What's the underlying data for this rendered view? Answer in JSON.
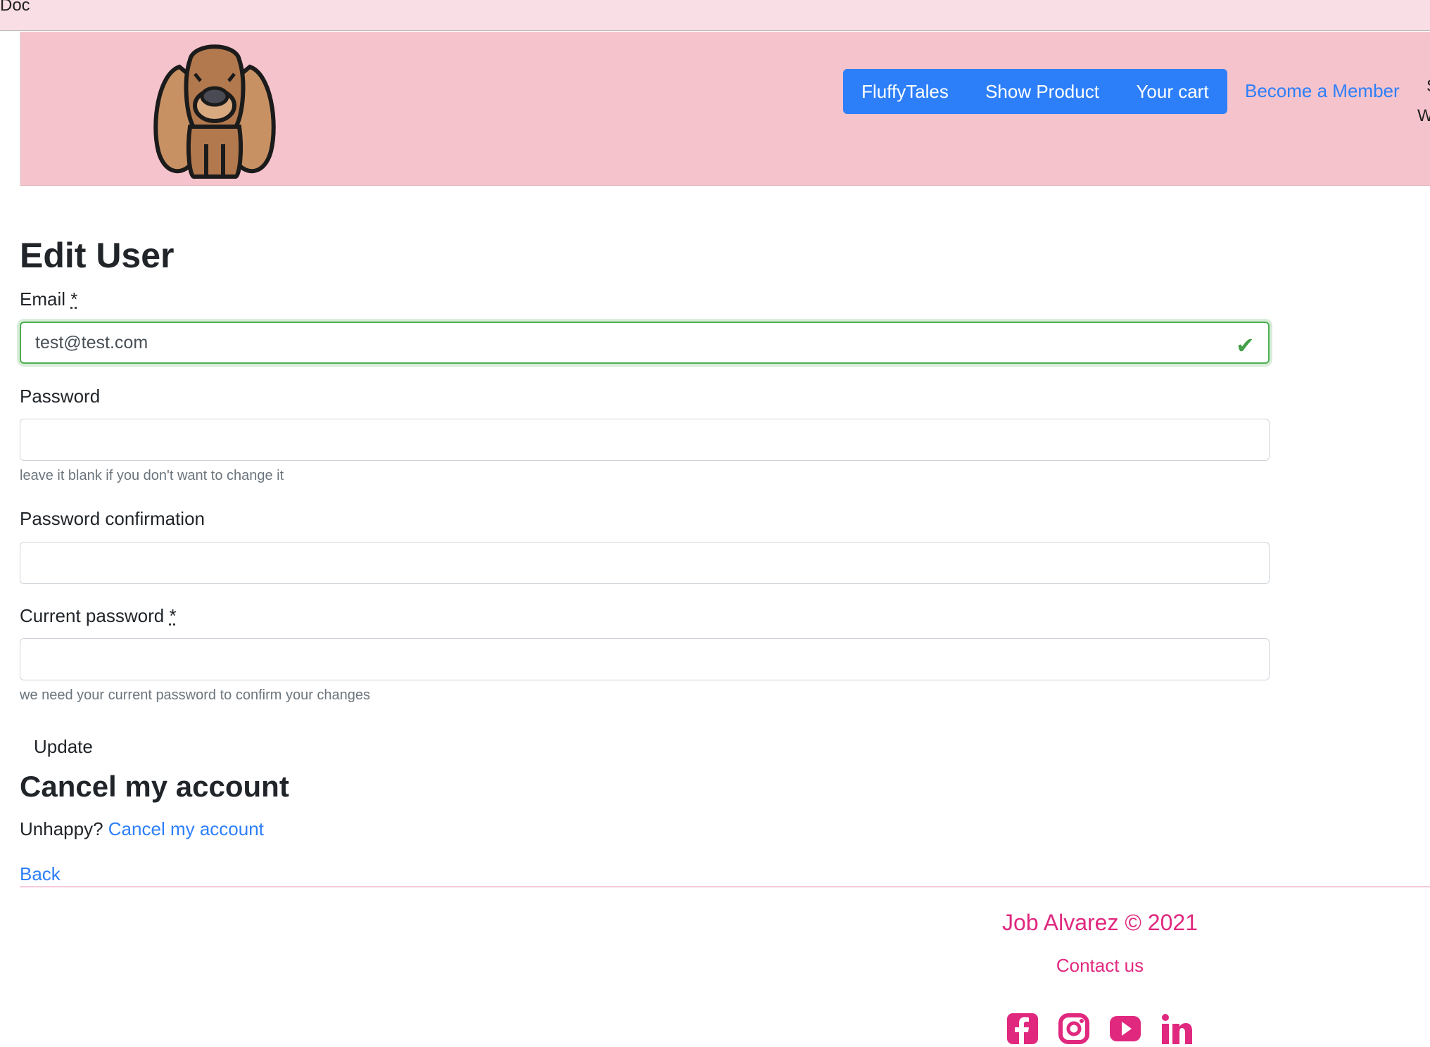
{
  "browser": {
    "tab_title": "Doc"
  },
  "nav": {
    "buttons": [
      "FluffyTales",
      "Show Product",
      "Your cart"
    ],
    "member_link": "Become a Member",
    "cut_text_1": "S",
    "cut_text_2": "W"
  },
  "form": {
    "title": "Edit User",
    "email_label": "Email",
    "required_marker": "*",
    "email_value": "test@test.com",
    "password_label": "Password",
    "password_help": "leave it blank if you don't want to change it",
    "password_confirmation_label": "Password confirmation",
    "current_password_label": "Current password",
    "current_password_help": "we need your current password to confirm your changes",
    "submit_label": "Update"
  },
  "cancel": {
    "title": "Cancel my account",
    "prompt": "Unhappy?",
    "link": "Cancel my account"
  },
  "back_link": "Back",
  "footer": {
    "copyright": "Job Alvarez © 2021",
    "contact": "Contact us",
    "social_icons": [
      "facebook-icon",
      "instagram-icon",
      "youtube-icon",
      "linkedin-icon"
    ]
  },
  "colors": {
    "header_bg": "#f5c3cc",
    "tab_bg": "#f9dfe5",
    "primary": "#2d7ff9",
    "footer_accent": "#e0287f",
    "valid": "#4caf50"
  }
}
